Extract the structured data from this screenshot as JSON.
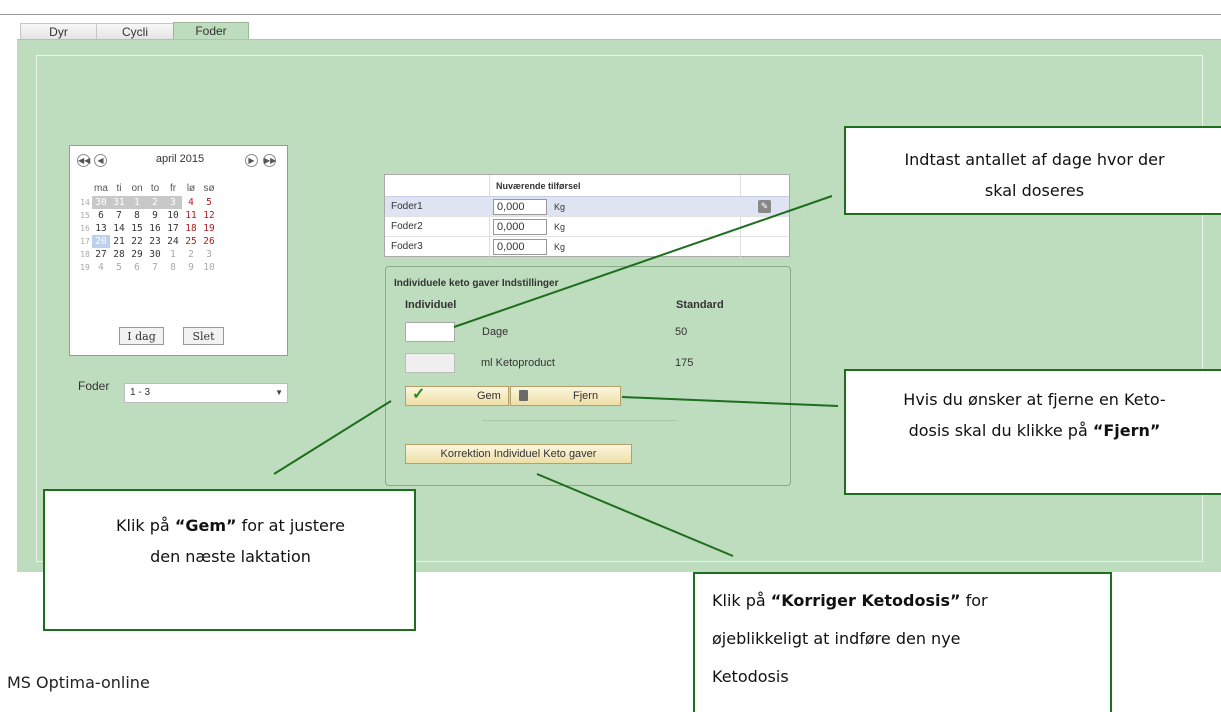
{
  "tabs": [
    {
      "label": "Dyr",
      "active": false
    },
    {
      "label": "Cycli",
      "active": false
    },
    {
      "label": "Foder",
      "active": true
    }
  ],
  "calendar": {
    "month_label": "april 2015",
    "weekdays": [
      "ma",
      "ti",
      "on",
      "to",
      "fr",
      "lø",
      "sø"
    ],
    "weeks": [
      {
        "wk": "14",
        "days": [
          [
            "30",
            "prev"
          ],
          [
            "31",
            "prev"
          ],
          [
            "1",
            "prev"
          ],
          [
            "2",
            "prev"
          ],
          [
            "3",
            "prev"
          ],
          [
            "4",
            "we"
          ],
          [
            "5",
            "we"
          ]
        ]
      },
      {
        "wk": "15",
        "days": [
          [
            "6",
            "norm"
          ],
          [
            "7",
            "norm"
          ],
          [
            "8",
            "norm"
          ],
          [
            "9",
            "norm"
          ],
          [
            "10",
            "norm"
          ],
          [
            "11",
            "we"
          ],
          [
            "12",
            "we"
          ]
        ]
      },
      {
        "wk": "16",
        "days": [
          [
            "13",
            "norm"
          ],
          [
            "14",
            "norm"
          ],
          [
            "15",
            "norm"
          ],
          [
            "16",
            "norm"
          ],
          [
            "17",
            "norm"
          ],
          [
            "18",
            "we"
          ],
          [
            "19",
            "we"
          ]
        ]
      },
      {
        "wk": "17",
        "days": [
          [
            "20",
            "today"
          ],
          [
            "21",
            "norm"
          ],
          [
            "22",
            "norm"
          ],
          [
            "23",
            "norm"
          ],
          [
            "24",
            "norm"
          ],
          [
            "25",
            "we"
          ],
          [
            "26",
            "we"
          ]
        ]
      },
      {
        "wk": "18",
        "days": [
          [
            "27",
            "norm"
          ],
          [
            "28",
            "norm"
          ],
          [
            "29",
            "norm"
          ],
          [
            "30",
            "norm"
          ],
          [
            "1",
            "next"
          ],
          [
            "2",
            "next"
          ],
          [
            "3",
            "next"
          ]
        ]
      },
      {
        "wk": "19",
        "days": [
          [
            "4",
            "next"
          ],
          [
            "5",
            "next"
          ],
          [
            "6",
            "next"
          ],
          [
            "7",
            "next"
          ],
          [
            "8",
            "next"
          ],
          [
            "9",
            "next"
          ],
          [
            "10",
            "next"
          ]
        ]
      }
    ],
    "today_button": "I dag",
    "clear_button": "Slet"
  },
  "foder_select": {
    "label": "Foder",
    "value": "1 - 3"
  },
  "feed_table": {
    "header": "Nuværende tilførsel",
    "rows": [
      {
        "name": "Foder1",
        "value": "0,000",
        "unit": "Kg"
      },
      {
        "name": "Foder2",
        "value": "0,000",
        "unit": "Kg"
      },
      {
        "name": "Foder3",
        "value": "0,000",
        "unit": "Kg"
      }
    ]
  },
  "keto": {
    "title": "Individuele keto gaver Indstillinger",
    "col_individual": "Individuel",
    "col_standard": "Standard",
    "days_label": "Dage",
    "days_standard": "50",
    "ml_label": "ml Ketoproduct",
    "ml_standard": "175",
    "save_button": "Gem",
    "remove_button": "Fjern",
    "correction_button": "Korrektion Individuel Keto gaver"
  },
  "callouts": {
    "days": {
      "line1": "Indtast antallet af dage hvor der",
      "line2": "skal doseres"
    },
    "remove": {
      "line1_pre": "Hvis du ønsker at fjerne en Keto-",
      "line2_pre": "dosis skal du klikke på ",
      "line2_bold": "“Fjern”"
    },
    "save": {
      "line1_pre": "Klik på ",
      "line1_bold": "“Gem”",
      "line1_post": " for at justere",
      "line2": "den næste laktation"
    },
    "correct": {
      "line1_pre": "Klik på ",
      "line1_bold": "“Korriger Ketodosis”",
      "line1_post": " for",
      "line2": "øjeblikkeligt at indføre den nye",
      "line3": "Ketodosis"
    }
  },
  "footer": "MS Optima-online",
  "colors": {
    "panel_bg": "#bedcbe",
    "callout_border": "#1e6e1e",
    "button_bg": "#f3e8bf"
  }
}
